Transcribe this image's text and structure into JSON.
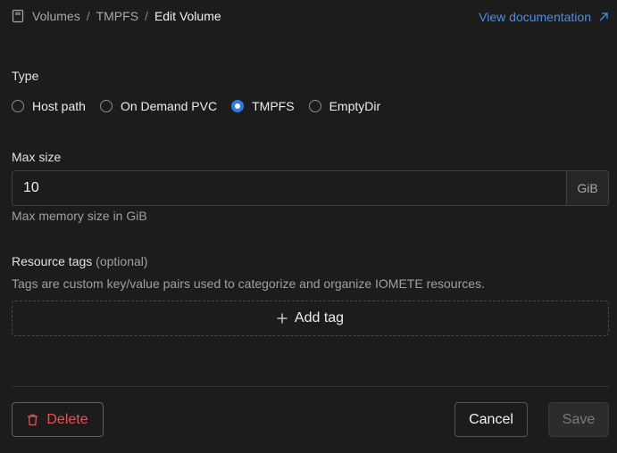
{
  "breadcrumb": {
    "items": [
      "Volumes",
      "TMPFS"
    ],
    "separator": "/",
    "current": "Edit Volume",
    "icon": "volume-icon"
  },
  "header": {
    "doc_link": "View documentation",
    "doc_icon": "external-link-icon"
  },
  "type_section": {
    "label": "Type",
    "options": [
      {
        "label": "Host path",
        "checked": false
      },
      {
        "label": "On Demand PVC",
        "checked": false
      },
      {
        "label": "TMPFS",
        "checked": true
      },
      {
        "label": "EmptyDir",
        "checked": false
      }
    ]
  },
  "max_size": {
    "label": "Max size",
    "value": "10",
    "unit": "GiB",
    "help": "Max memory size in GiB"
  },
  "resource_tags": {
    "label": "Resource tags",
    "optional": "(optional)",
    "description": "Tags are custom key/value pairs used to categorize and organize IOMETE resources.",
    "add_label": "Add tag"
  },
  "footer": {
    "delete_label": "Delete",
    "cancel_label": "Cancel",
    "save_label": "Save"
  },
  "colors": {
    "accent": "#2f7be5",
    "link": "#4a8fe2",
    "danger": "#e05555",
    "background": "#1c1c1c"
  }
}
